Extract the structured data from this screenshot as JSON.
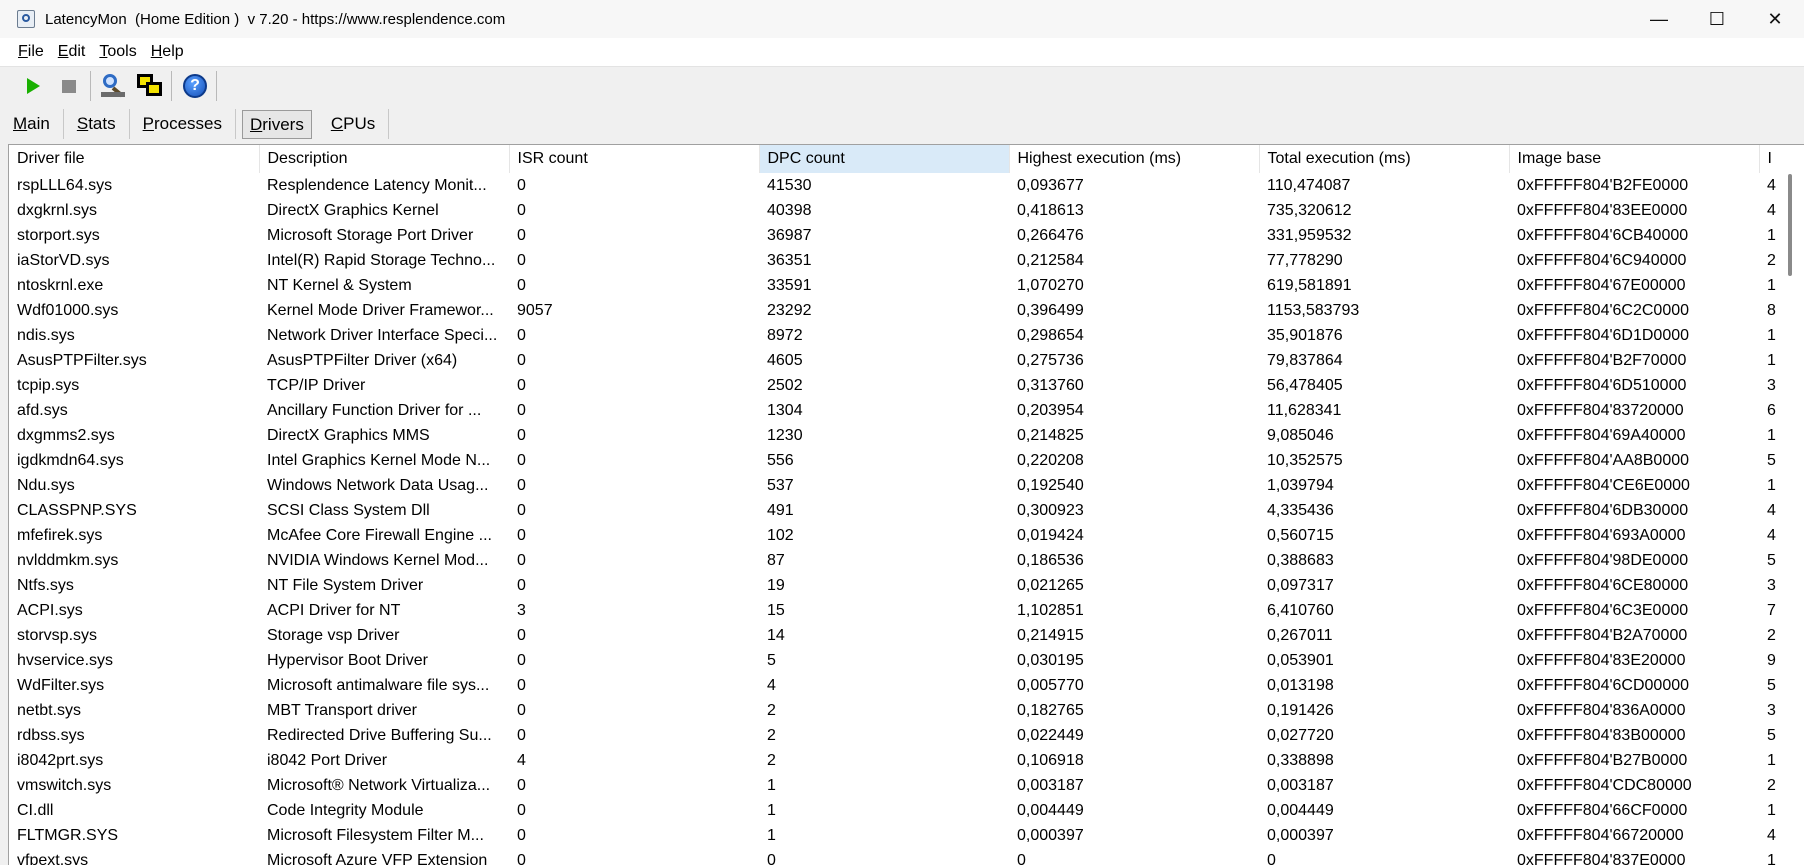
{
  "window": {
    "title": "LatencyMon  (Home Edition )  v 7.20 - https://www.resplendence.com",
    "minimize_glyph": "—",
    "maximize_glyph": "☐",
    "close_glyph": "✕"
  },
  "menu": [
    {
      "u": "F",
      "rest": "ile"
    },
    {
      "u": "E",
      "rest": "dit"
    },
    {
      "u": "T",
      "rest": "ools"
    },
    {
      "u": "H",
      "rest": "elp"
    }
  ],
  "toolbar": {
    "icons": [
      "play-icon",
      "stop-icon",
      "monitor-icon",
      "windows-icon",
      "help-icon"
    ],
    "help_glyph": "?"
  },
  "tabs": [
    {
      "u": "M",
      "rest": "ain",
      "active": false
    },
    {
      "u": "S",
      "rest": "tats",
      "active": false
    },
    {
      "u": "P",
      "rest": "rocesses",
      "active": false
    },
    {
      "u": "D",
      "rest": "rivers",
      "active": true
    },
    {
      "u": "C",
      "rest": "PUs",
      "active": false
    }
  ],
  "table": {
    "columns": [
      "Driver file",
      "Description",
      "ISR count",
      "DPC count",
      "Highest execution (ms)",
      "Total execution (ms)",
      "Image base",
      "I"
    ],
    "sorted_column": 3,
    "rows": [
      [
        "rspLLL64.sys",
        "Resplendence Latency Monit...",
        "0",
        "41530",
        "0,093677",
        "110,474087",
        "0xFFFFF804'B2FE0000",
        "4"
      ],
      [
        "dxgkrnl.sys",
        "DirectX Graphics Kernel",
        "0",
        "40398",
        "0,418613",
        "735,320612",
        "0xFFFFF804'83EE0000",
        "4"
      ],
      [
        "storport.sys",
        "Microsoft Storage Port Driver",
        "0",
        "36987",
        "0,266476",
        "331,959532",
        "0xFFFFF804'6CB40000",
        "1"
      ],
      [
        "iaStorVD.sys",
        "Intel(R) Rapid Storage Techno...",
        "0",
        "36351",
        "0,212584",
        "77,778290",
        "0xFFFFF804'6C940000",
        "2"
      ],
      [
        "ntoskrnl.exe",
        "NT Kernel & System",
        "0",
        "33591",
        "1,070270",
        "619,581891",
        "0xFFFFF804'67E00000",
        "1"
      ],
      [
        "Wdf01000.sys",
        "Kernel Mode Driver Framewor...",
        "9057",
        "23292",
        "0,396499",
        "1153,583793",
        "0xFFFFF804'6C2C0000",
        "8"
      ],
      [
        "ndis.sys",
        "Network Driver Interface Speci...",
        "0",
        "8972",
        "0,298654",
        "35,901876",
        "0xFFFFF804'6D1D0000",
        "1"
      ],
      [
        "AsusPTPFilter.sys",
        "AsusPTPFilter Driver (x64)",
        "0",
        "4605",
        "0,275736",
        "79,837864",
        "0xFFFFF804'B2F70000",
        "1"
      ],
      [
        "tcpip.sys",
        "TCP/IP Driver",
        "0",
        "2502",
        "0,313760",
        "56,478405",
        "0xFFFFF804'6D510000",
        "3"
      ],
      [
        "afd.sys",
        "Ancillary Function Driver for ...",
        "0",
        "1304",
        "0,203954",
        "11,628341",
        "0xFFFFF804'83720000",
        "6"
      ],
      [
        "dxgmms2.sys",
        "DirectX Graphics MMS",
        "0",
        "1230",
        "0,214825",
        "9,085046",
        "0xFFFFF804'69A40000",
        "1"
      ],
      [
        "igdkmdn64.sys",
        "Intel Graphics Kernel Mode N...",
        "0",
        "556",
        "0,220208",
        "10,352575",
        "0xFFFFF804'AA8B0000",
        "5"
      ],
      [
        "Ndu.sys",
        "Windows Network Data Usag...",
        "0",
        "537",
        "0,192540",
        "1,039794",
        "0xFFFFF804'CE6E0000",
        "1"
      ],
      [
        "CLASSPNP.SYS",
        "SCSI Class System Dll",
        "0",
        "491",
        "0,300923",
        "4,335436",
        "0xFFFFF804'6DB30000",
        "4"
      ],
      [
        "mfefirek.sys",
        "McAfee Core Firewall Engine ...",
        "0",
        "102",
        "0,019424",
        "0,560715",
        "0xFFFFF804'693A0000",
        "4"
      ],
      [
        "nvlddmkm.sys",
        "NVIDIA Windows Kernel Mod...",
        "0",
        "87",
        "0,186536",
        "0,388683",
        "0xFFFFF804'98DE0000",
        "5"
      ],
      [
        "Ntfs.sys",
        "NT File System Driver",
        "0",
        "19",
        "0,021265",
        "0,097317",
        "0xFFFFF804'6CE80000",
        "3"
      ],
      [
        "ACPI.sys",
        "ACPI Driver for NT",
        "3",
        "15",
        "1,102851",
        "6,410760",
        "0xFFFFF804'6C3E0000",
        "7"
      ],
      [
        "storvsp.sys",
        "Storage vsp Driver",
        "0",
        "14",
        "0,214915",
        "0,267011",
        "0xFFFFF804'B2A70000",
        "2"
      ],
      [
        "hvservice.sys",
        "Hypervisor Boot Driver",
        "0",
        "5",
        "0,030195",
        "0,053901",
        "0xFFFFF804'83E20000",
        "9"
      ],
      [
        "WdFilter.sys",
        "Microsoft antimalware file sys...",
        "0",
        "4",
        "0,005770",
        "0,013198",
        "0xFFFFF804'6CD00000",
        "5"
      ],
      [
        "netbt.sys",
        "MBT Transport driver",
        "0",
        "2",
        "0,182765",
        "0,191426",
        "0xFFFFF804'836A0000",
        "3"
      ],
      [
        "rdbss.sys",
        "Redirected Drive Buffering Su...",
        "0",
        "2",
        "0,022449",
        "0,027720",
        "0xFFFFF804'83B00000",
        "5"
      ],
      [
        "i8042prt.sys",
        "i8042 Port Driver",
        "4",
        "2",
        "0,106918",
        "0,338898",
        "0xFFFFF804'B27B0000",
        "1"
      ],
      [
        "vmswitch.sys",
        "Microsoft® Network Virtualiza...",
        "0",
        "1",
        "0,003187",
        "0,003187",
        "0xFFFFF804'CDC80000",
        "2"
      ],
      [
        "CI.dll",
        "Code Integrity Module",
        "0",
        "1",
        "0,004449",
        "0,004449",
        "0xFFFFF804'66CF0000",
        "1"
      ],
      [
        "FLTMGR.SYS",
        "Microsoft Filesystem Filter M...",
        "0",
        "1",
        "0,000397",
        "0,000397",
        "0xFFFFF804'66720000",
        "4"
      ],
      [
        "vfpext.sys",
        "Microsoft Azure VFP Extension",
        "0",
        "0",
        "0",
        "0",
        "0xFFFFF804'837E0000",
        "1"
      ]
    ]
  }
}
